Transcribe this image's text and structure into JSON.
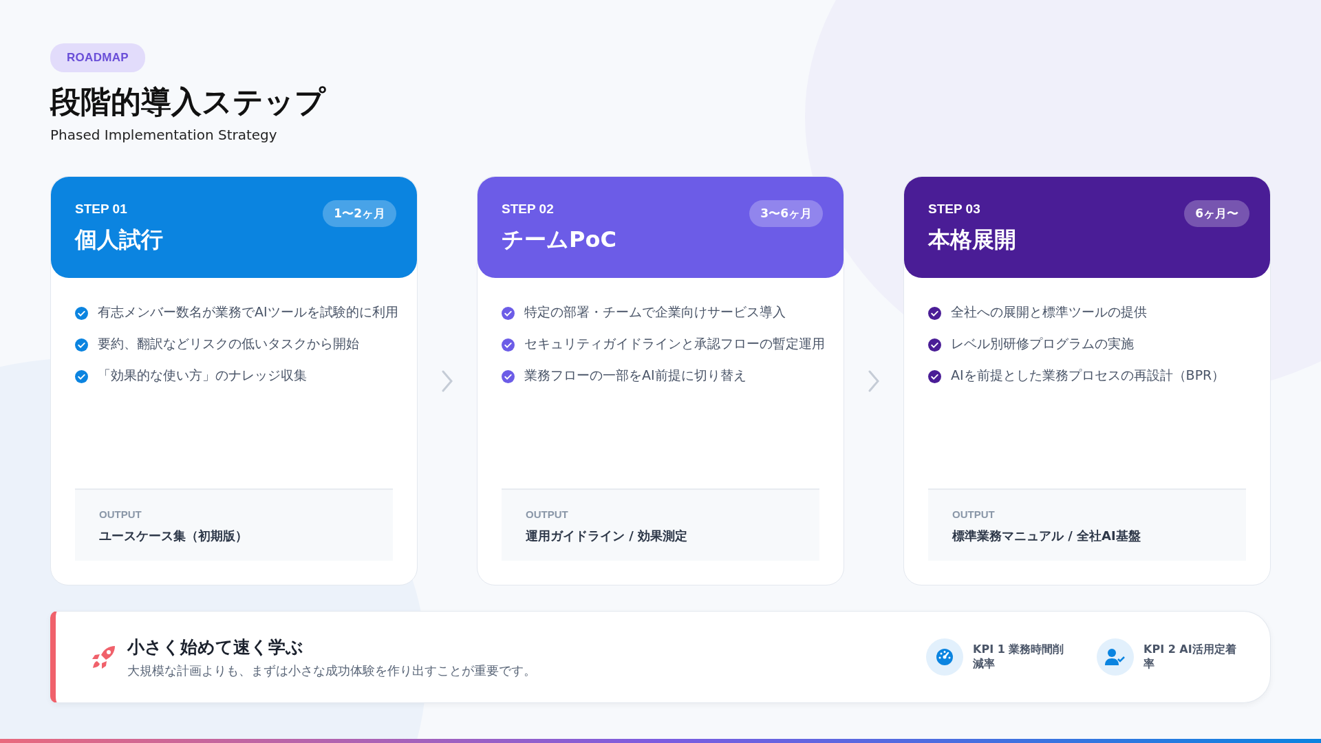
{
  "badge": "ROADMAP",
  "title": "段階的導入ステップ",
  "subtitle": "Phased Implementation Strategy",
  "steps": [
    {
      "step": "STEP 01",
      "title": "個人試行",
      "duration": "1〜2ヶ月",
      "color": "#0b84e0",
      "items": [
        "有志メンバー数名が業務でAIツールを試験的に利用",
        "要約、翻訳などリスクの低いタスクから開始",
        "「効果的な使い方」のナレッジ収集"
      ],
      "output_label": "OUTPUT",
      "output": "ユースケース集（初期版）"
    },
    {
      "step": "STEP 02",
      "title": "チームPoC",
      "duration": "3〜6ヶ月",
      "color": "#6c5ce7",
      "items": [
        "特定の部署・チームで企業向けサービス導入",
        "セキュリティガイドラインと承認フローの暫定運用",
        "業務フローの一部をAI前提に切り替え"
      ],
      "output_label": "OUTPUT",
      "output": "運用ガイドライン / 効果測定"
    },
    {
      "step": "STEP 03",
      "title": "本格展開",
      "duration": "6ヶ月〜",
      "color": "#4a1d96",
      "items": [
        "全社への展開と標準ツールの提供",
        "レベル別研修プログラムの実施",
        "AIを前提とした業務プロセスの再設計（BPR）"
      ],
      "output_label": "OUTPUT",
      "output": "標準業務マニュアル / 全社AI基盤"
    }
  ],
  "summary": {
    "title": "小さく始めて速く学ぶ",
    "text": "大規模な計画よりも、まずは小さな成功体験を作り出すことが重要です。"
  },
  "kpis": [
    {
      "kind": "gauge",
      "label": "KPI 1 業務時間削減率"
    },
    {
      "kind": "user",
      "label": "KPI 2 AI活用定着率"
    }
  ]
}
